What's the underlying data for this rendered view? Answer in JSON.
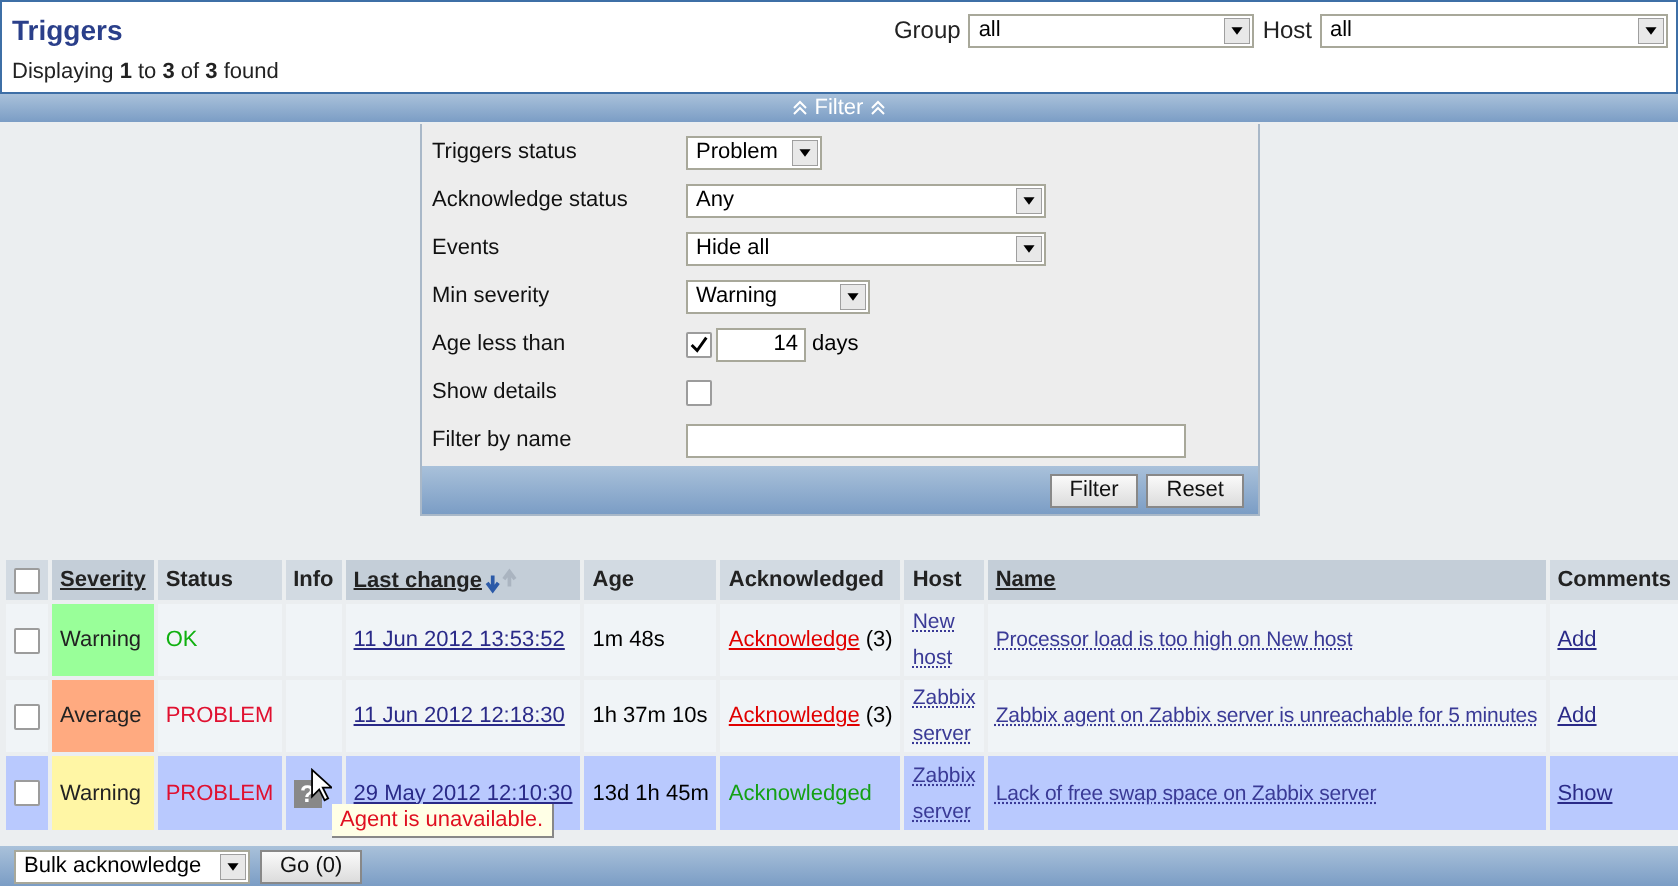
{
  "header": {
    "title": "Triggers",
    "summary": "Displaying **1** to **3** of **3** found",
    "selects": [
      {
        "label": "Group",
        "value": "all"
      },
      {
        "label": "Host",
        "value": "all"
      }
    ]
  },
  "filter_bar": {
    "label": "Filter"
  },
  "filter": {
    "rows": [
      {
        "label": "Triggers status",
        "kind": "select",
        "value": "Problem"
      },
      {
        "label": "Acknowledge status",
        "kind": "select",
        "value": "Any"
      },
      {
        "label": "Events",
        "kind": "select",
        "value": "Hide all"
      },
      {
        "label": "Min severity",
        "kind": "select",
        "value": "Warning"
      },
      {
        "label": "Age less than",
        "kind": "age",
        "checked": true,
        "value": "14",
        "unit": "days"
      },
      {
        "label": "Show details",
        "kind": "checkbox",
        "checked": false
      },
      {
        "label": "Filter by name",
        "kind": "text"
      }
    ],
    "buttons": [
      "Filter",
      "Reset"
    ]
  },
  "table": {
    "select_all": {
      "checked": false
    },
    "columns": [
      {
        "label": "Severity",
        "sortable": true,
        "sorted": false
      },
      {
        "label": "Status",
        "sortable": false,
        "sorted": false
      },
      {
        "label": "Info",
        "sortable": false,
        "sorted": false
      },
      {
        "label": "Last change",
        "sortable": true,
        "sorted": true
      },
      {
        "label": "Age",
        "sortable": false,
        "sorted": false
      },
      {
        "label": "Acknowledged",
        "sortable": false,
        "sorted": false
      },
      {
        "label": "Host",
        "sortable": false,
        "sorted": false
      },
      {
        "label": "Name",
        "sortable": true,
        "sorted": false
      },
      {
        "label": "Comments",
        "sortable": false,
        "sorted": false
      }
    ],
    "rows": [
      {
        "highlighted": false,
        "checked": false,
        "severity": "Warning",
        "color": "#99ff99",
        "status": "OK",
        "problem": false,
        "last_change": "11 Jun 2012 13:53:52",
        "age": "1m 48s",
        "ack": {
          "acknowledged": false,
          "text": "Acknowledge",
          "count": "(3)"
        },
        "host": "New host",
        "name": "Processor load is too high on New host",
        "comment": "Add"
      },
      {
        "highlighted": false,
        "checked": false,
        "severity": "Average",
        "color": "#ffaa80",
        "status": "PROBLEM",
        "problem": true,
        "last_change": "11 Jun 2012 12:18:30",
        "age": "1h 37m 10s",
        "ack": {
          "acknowledged": false,
          "text": "Acknowledge",
          "count": "(3)"
        },
        "host": "Zabbix server",
        "name": "Zabbix agent on Zabbix server is unreachable for 5 minutes",
        "comment": "Add"
      },
      {
        "highlighted": true,
        "checked": false,
        "severity": "Warning",
        "color": "#fff6a5",
        "status": "PROBLEM",
        "problem": true,
        "info": "?",
        "last_change": "29 May 2012 12:10:30",
        "age": "13d 1h 45m",
        "ack": {
          "acknowledged": true,
          "text": "Acknowledged"
        },
        "host": "Zabbix server",
        "name": "Lack of free swap space on Zabbix server",
        "comment": "Show"
      }
    ]
  },
  "tooltip": "Agent is unavailable.",
  "footer": {
    "action": "Bulk acknowledge",
    "button": "Go (0)"
  }
}
